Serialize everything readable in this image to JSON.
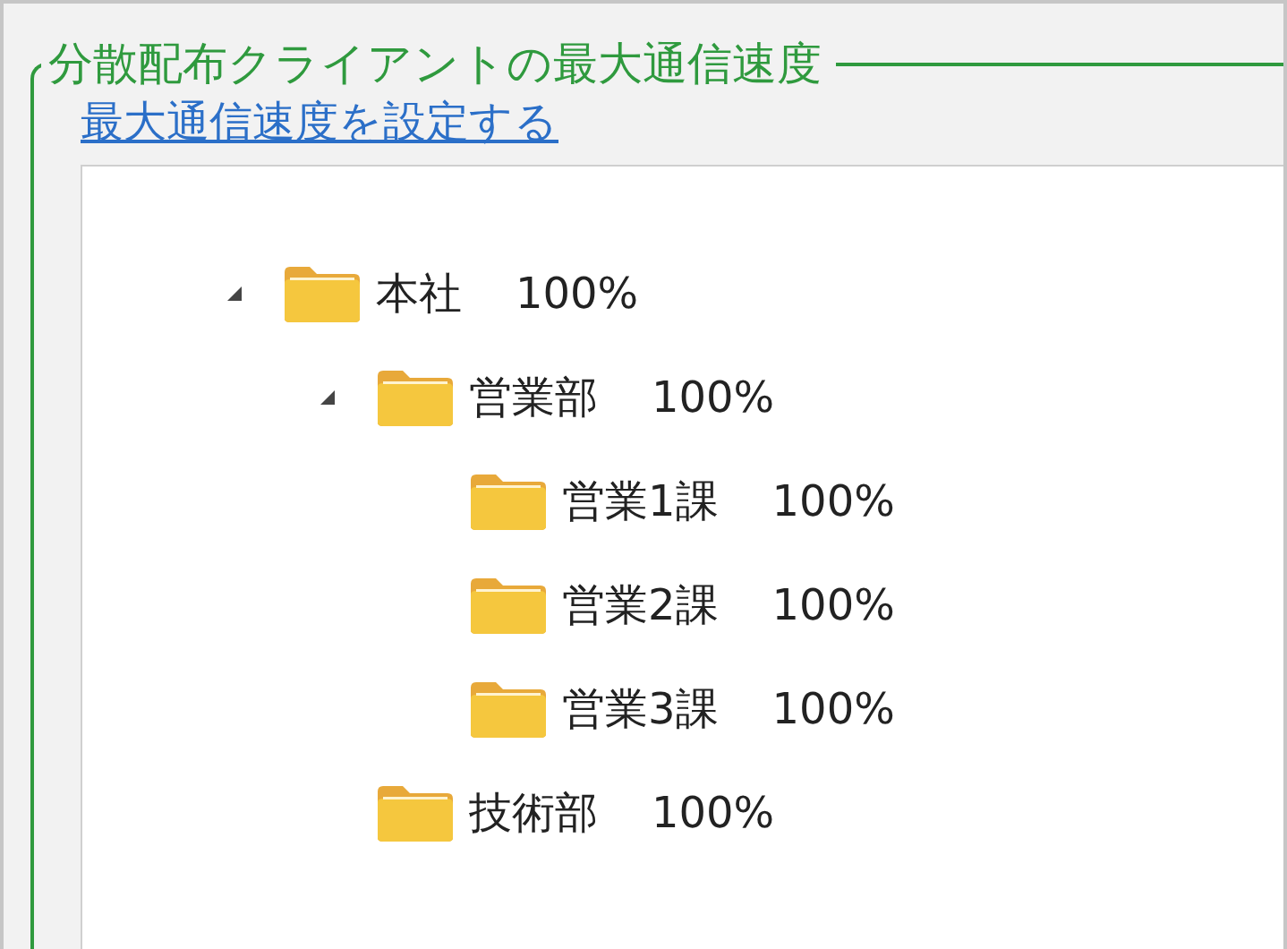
{
  "group": {
    "title": "分散配布クライアントの最大通信速度",
    "link": "最大通信速度を設定する",
    "tree": [
      {
        "name": "本社",
        "rate": "100%",
        "expanded": true,
        "children": [
          {
            "name": "営業部",
            "rate": "100%",
            "expanded": true,
            "children": [
              {
                "name": "営業1課",
                "rate": "100%"
              },
              {
                "name": "営業2課",
                "rate": "100%"
              },
              {
                "name": "営業3課",
                "rate": "100%"
              }
            ]
          },
          {
            "name": "技術部",
            "rate": "100%"
          }
        ]
      }
    ]
  }
}
